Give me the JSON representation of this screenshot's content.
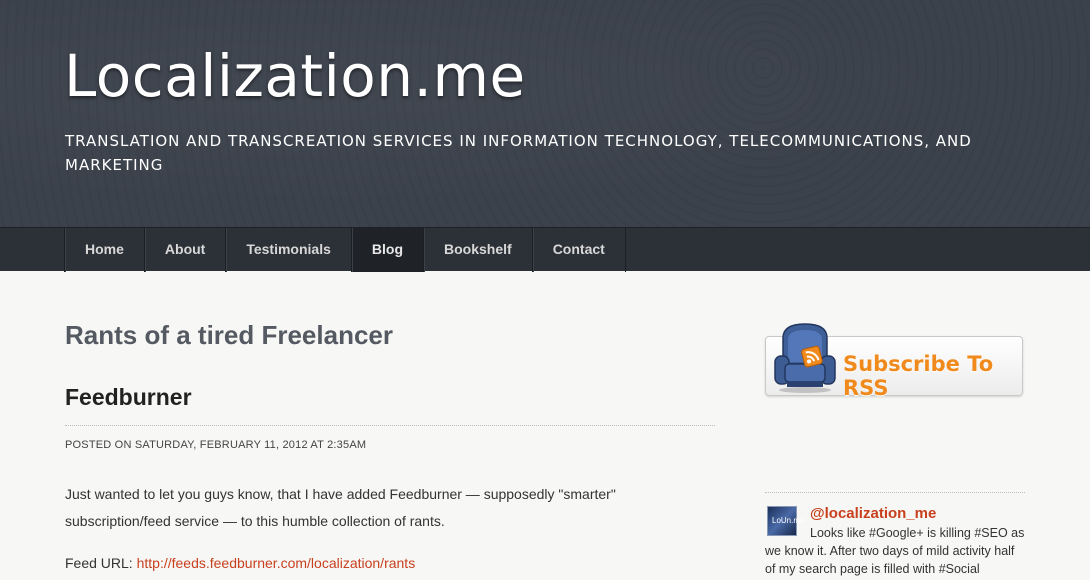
{
  "header": {
    "site_title": "Localization.me",
    "tagline": "TRANSLATION AND TRANSCREATION SERVICES IN INFORMATION TECHNOLOGY, TELECOMMUNICATIONS, AND MARKETING"
  },
  "nav": {
    "items": [
      {
        "label": "Home"
      },
      {
        "label": "About"
      },
      {
        "label": "Testimonials"
      },
      {
        "label": "Blog"
      },
      {
        "label": "Bookshelf"
      },
      {
        "label": "Contact"
      }
    ],
    "active": "Blog"
  },
  "main": {
    "page_title": "Rants of a tired Freelancer",
    "post": {
      "title": "Feedburner",
      "meta": "POSTED ON SATURDAY, FEBRUARY 11, 2012 AT 2:35AM",
      "body": "Just wanted to let you guys know, that I have added Feedburner — supposedly \"smarter\" subscription/feed service — to this humble collection of rants.",
      "feed_label": "Feed URL: ",
      "feed_url": "http://feeds.feedburner.com/localization/rants"
    }
  },
  "sidebar": {
    "rss_banner": {
      "text": "Subscribe To RSS",
      "icon": "armchair-rss-icon"
    },
    "twitter": {
      "avatar_text": "LoUn.me",
      "handle": "@localization_me",
      "text": "Looks like #Google+ is killing #SEO as we know it. After two days of mild activity half of my search page is filled with #Social"
    }
  },
  "colors": {
    "header_bg": "#3c424c",
    "nav_bg": "#2c3037",
    "link": "#c8401e",
    "rss_orange": "#f08a1c"
  }
}
